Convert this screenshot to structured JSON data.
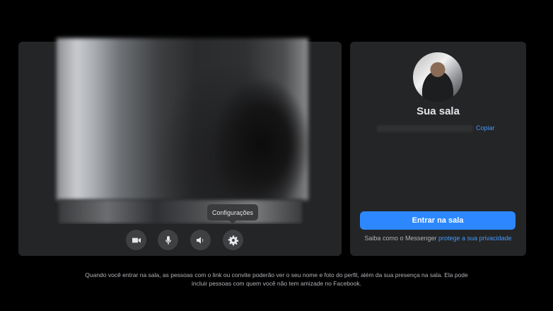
{
  "preview": {
    "tooltip": "Configurações",
    "controls": [
      {
        "name": "camera",
        "icon": "video-camera-icon"
      },
      {
        "name": "microphone",
        "icon": "microphone-icon"
      },
      {
        "name": "speaker",
        "icon": "speaker-icon"
      },
      {
        "name": "settings",
        "icon": "gear-icon"
      }
    ]
  },
  "room": {
    "title": "Sua sala",
    "copy_label": "Copiar",
    "join_button": "Entrar na sala",
    "privacy_prefix": "Saiba como o Messenger ",
    "privacy_link": "protege a sua privacidade"
  },
  "footer": {
    "note": "Quando você entrar na sala, as pessoas com o link ou convite poderão ver o seu nome e foto do perfil, além da sua presença na sala. Ela pode incluir pessoas com quem você não tem amizade no Facebook."
  },
  "colors": {
    "accent": "#2d88ff",
    "link": "#4599ff",
    "panel": "#242526",
    "background": "#000000"
  }
}
